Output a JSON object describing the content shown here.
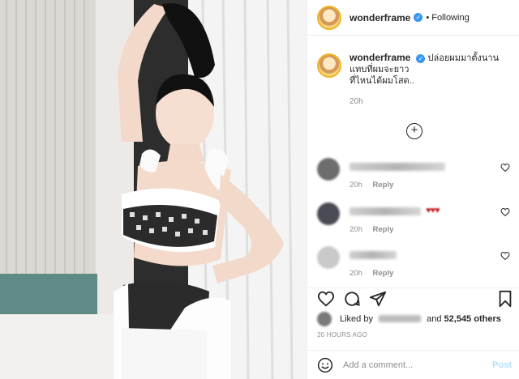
{
  "header": {
    "username": "wonderframe",
    "separator": "•",
    "follow_status": "Following"
  },
  "caption": {
    "username": "wonderframe",
    "text": "ปล่อยผมมาตั้งนาน\nแทบที่ผมจะยาว\nที่ไหนได้ผมโสด..",
    "time": "20h"
  },
  "comments": [
    {
      "time": "20h",
      "reply_label": "Reply",
      "emoji": ""
    },
    {
      "time": "20h",
      "reply_label": "Reply",
      "emoji": "♥♥♥"
    },
    {
      "time": "20h",
      "reply_label": "Reply",
      "emoji": ""
    }
  ],
  "likes": {
    "prefix": "Liked by",
    "conjunction": "and",
    "count": "52,545 others"
  },
  "posted_time": "20 HOURS AGO",
  "add_comment": {
    "placeholder": "Add a comment...",
    "post_label": "Post"
  },
  "icons": {
    "verified": "verified-badge-icon",
    "load_more": "plus-circle-icon",
    "like": "heart-icon",
    "comment": "comment-bubble-icon",
    "share": "paper-plane-icon",
    "save": "bookmark-icon",
    "emoji": "smiley-icon"
  },
  "colors": {
    "verified_blue": "#3897f0",
    "post_button_disabled": "#b2dffc",
    "secondary_text": "#8e8e8e"
  }
}
